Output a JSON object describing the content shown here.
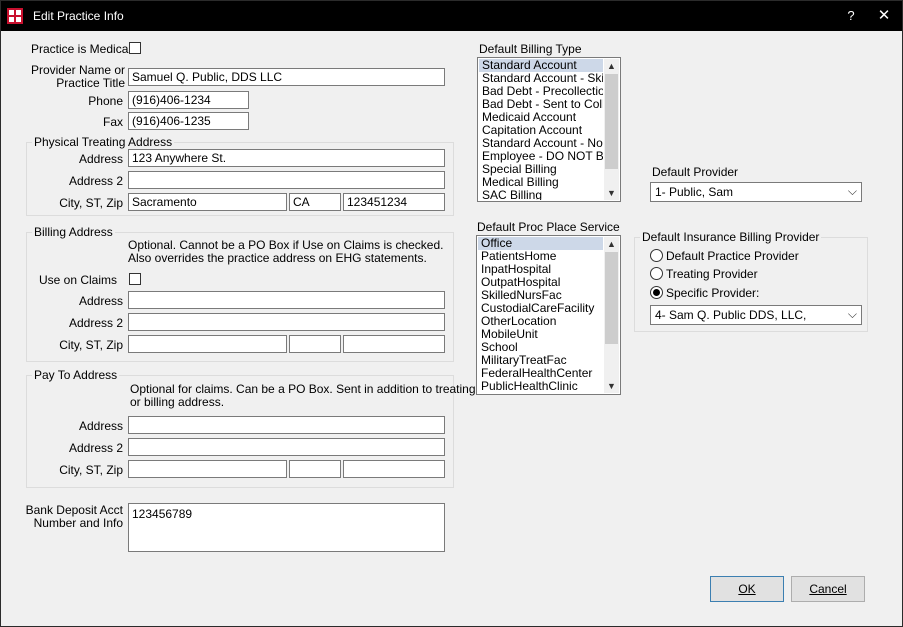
{
  "window": {
    "title": "Edit Practice Info",
    "help": "?",
    "close": "✕"
  },
  "practice": {
    "is_medical_label": "Practice is Medical",
    "provider_label_1": "Provider Name or",
    "provider_label_2": "Practice Title",
    "provider_value": "Samuel Q. Public, DDS LLC",
    "phone_label": "Phone",
    "phone_value": "(916)406-1234",
    "fax_label": "Fax",
    "fax_value": "(916)406-1235"
  },
  "physical": {
    "group_title": "Physical Treating Address",
    "address_label": "Address",
    "address_value": "123 Anywhere St.",
    "address2_label": "Address 2",
    "address2_value": "",
    "city_label": "City, ST, Zip",
    "city_value": "Sacramento",
    "state_value": "CA",
    "zip_value": "123451234"
  },
  "billing": {
    "group_title": "Billing Address",
    "note_1": "Optional.  Cannot be a PO Box if Use on Claims is checked.",
    "note_2": "Also overrides the practice address on EHG statements.",
    "use_on_claims_label": "Use on Claims",
    "address_label": "Address",
    "address2_label": "Address 2",
    "city_label": "City, ST, Zip"
  },
  "payto": {
    "group_title": "Pay To Address",
    "note_1": "Optional for claims.  Can be a PO Box.  Sent in addition to treating",
    "note_2": "or billing address.",
    "address_label": "Address",
    "address2_label": "Address 2",
    "city_label": "City, ST, Zip"
  },
  "bank": {
    "label_1": "Bank Deposit Acct",
    "label_2": "Number and Info",
    "value": "123456789"
  },
  "billing_type": {
    "label": "Default Billing Type",
    "items": [
      "Standard Account",
      "Standard Account - Skip",
      "Bad Debt - Precollections",
      "Bad Debt - Sent to Colle",
      "Medicaid Account",
      "Capitation Account",
      "Standard Account - No F",
      "Employee - DO NOT BIL",
      "Special Billing",
      "Medical Billing",
      "SAC Billing"
    ]
  },
  "proc_place": {
    "label": "Default Proc Place Service",
    "items": [
      "Office",
      "PatientsHome",
      "InpatHospital",
      "OutpatHospital",
      "SkilledNursFac",
      "CustodialCareFacility",
      "OtherLocation",
      "MobileUnit",
      "School",
      "MilitaryTreatFac",
      "FederalHealthCenter",
      "PublicHealthClinic"
    ]
  },
  "provider": {
    "label": "Default Provider",
    "value": "1- Public, Sam"
  },
  "ins_billing": {
    "group_title": "Default Insurance Billing Provider",
    "opt_practice": "Default Practice Provider",
    "opt_treating": "Treating Provider",
    "opt_specific": "Specific Provider:",
    "specific_value": "4- Sam Q. Public DDS, LLC,"
  },
  "buttons": {
    "ok": "OK",
    "cancel": "Cancel"
  }
}
